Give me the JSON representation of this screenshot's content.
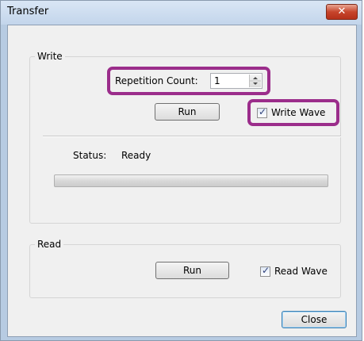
{
  "window": {
    "title": "Transfer",
    "close_glyph": "✕"
  },
  "write": {
    "legend": "Write",
    "repetition_label": "Repetition Count:",
    "repetition_value": "1",
    "run_label": "Run",
    "write_wave_label": "Write Wave",
    "write_wave_checked": true,
    "status_label": "Status:",
    "status_value": "Ready",
    "progress": 0
  },
  "read": {
    "legend": "Read",
    "run_label": "Run",
    "read_wave_label": "Read Wave",
    "read_wave_checked": true
  },
  "footer": {
    "close_label": "Close"
  },
  "colors": {
    "highlight": "#9b2d8b",
    "checkmark": "#2d3f7a"
  }
}
